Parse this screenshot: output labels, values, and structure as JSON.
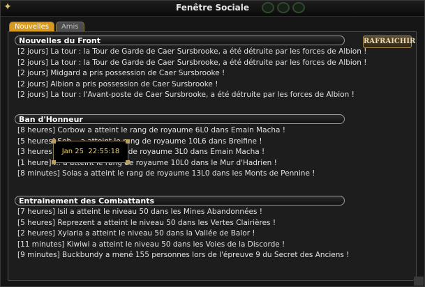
{
  "window": {
    "title": "Fenêtre Sociale"
  },
  "tabs": [
    {
      "label": "Nouvelles"
    },
    {
      "label": "Amis"
    }
  ],
  "refresh_label": "RAFRAICHIR",
  "sections": [
    {
      "heading": "Nouvelles du Front",
      "items": [
        "[2 jours] La tour : la Tour de Garde de Caer Sursbrooke, a été détruite par les forces de Albion !",
        "[2 jours] La tour : la Tour de Garde de Caer Sursbrooke, a été détruite par les forces de Albion !",
        "[2 jours] Midgard a pris possession de Caer Sursbrooke !",
        "[2 jours] Albion a pris possession de Caer Sursbrooke !",
        "[2 jours] La tour : l'Avant-poste de Caer Sursbrooke, a été détruite par les forces de Albion !"
      ]
    },
    {
      "heading": "Ban d'Honneur",
      "items": [
        "[8 heures] Corbow a atteint le rang de royaume 6L0 dans Emain Macha !",
        "[5 heures] Seh... a atteint le rang de royaume 10L6 dans Breifine !",
        "[3 heures] ... a atteint le rang de royaume 3L0 dans Emain Macha !",
        "[1 heure] ... a atteint le rang de royaume 10L0 dans le Mur d'Hadrien !",
        "[8 minutes] Solas a atteint le rang de royaume 13L0 dans les Monts de Pennine !"
      ]
    },
    {
      "heading": "Entrainement des Combattants",
      "items": [
        "[7 heures] Isil a atteint le niveau 50 dans les Mines Abandonnées !",
        "[5 heures] Reprezent a atteint le niveau 50 dans les Vertes Clairières !",
        "[2 heures] Xylaria a atteint le niveau 50 dans la Vallée de Balor !",
        "[11 minutes] Kiwiwi a atteint le niveau 50 dans les Voies de la Discorde !",
        "[9 minutes] Buckbundy a mené 155 personnes lors de l'épreuve 9 du Secret des Anciens !"
      ]
    }
  ],
  "tooltip": {
    "date": "Jan 25",
    "time": "22:55:18"
  },
  "colors": {
    "accent": "#d79a1f",
    "tooltip_text": "#f2d45a",
    "background": "#1d1d1d"
  }
}
